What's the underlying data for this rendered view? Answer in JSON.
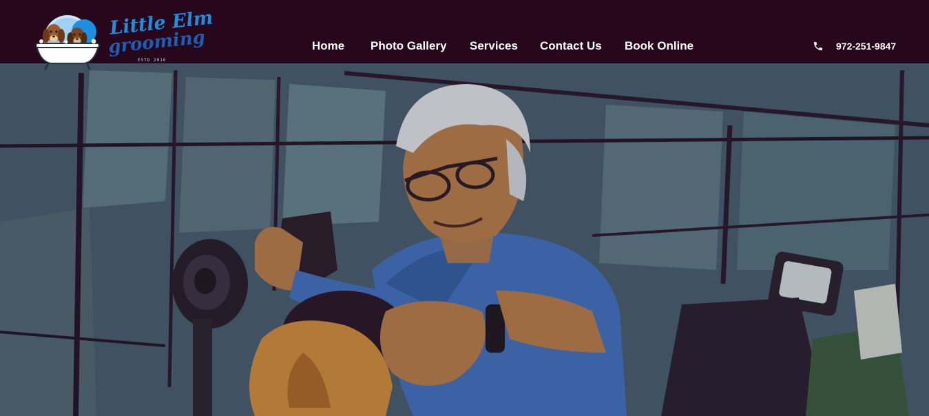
{
  "brand": {
    "line1": "Little Elm",
    "line2": "grooming",
    "established": "ESTD 2016",
    "colors": {
      "primary": "#1e8fe0",
      "secondary": "#1a5fb3",
      "header_bg": "#26071b"
    }
  },
  "nav": {
    "items": [
      {
        "label": "Home"
      },
      {
        "label": "Photo Gallery"
      },
      {
        "label": "Services"
      },
      {
        "label": "Contact Us"
      },
      {
        "label": "Book Online"
      }
    ]
  },
  "contact": {
    "icon": "phone-icon",
    "phone": "972-251-9847"
  },
  "hero": {
    "image": "groomer-blow-drying-dog-photo"
  }
}
